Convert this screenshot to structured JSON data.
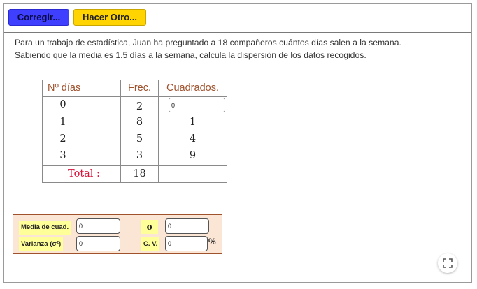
{
  "toolbar": {
    "fix_label": "Corregir...",
    "new_label": "Hacer Otro..."
  },
  "problem": {
    "line1": "Para un trabajo de estadística, Juan ha preguntado a 18 compañeros cuántos días salen a la semana.",
    "line2": "Sabiendo que la media es 1.5 días a la semana, calcula la dispersión de los datos recogidos."
  },
  "table": {
    "headers": [
      "Nº días",
      "Frec.",
      "Cuadrados."
    ],
    "rows": [
      {
        "days": "0",
        "freq": "2",
        "square": "0"
      },
      {
        "days": "1",
        "freq": "8",
        "square": "1"
      },
      {
        "days": "2",
        "freq": "5",
        "square": "4"
      },
      {
        "days": "3",
        "freq": "3",
        "square": "9"
      }
    ],
    "total_label": "Total :",
    "total_value": "18"
  },
  "results": {
    "mean_sq_label": "Media de cuad.",
    "mean_sq_value": "0",
    "variance_label": "Varianza (σ²)",
    "variance_value": "0",
    "sigma_label": "σ",
    "sigma_value": "0",
    "cv_label": "C. V.",
    "cv_value": "0",
    "percent": "%"
  },
  "colors": {
    "fix_button": "#3f3fff",
    "new_button": "#ffd400",
    "header_text": "#a0522d",
    "total_text": "#dc143c",
    "panel_bg": "#fbe5d4",
    "label_bg": "#ffff99"
  },
  "icons": {
    "fullscreen": "fullscreen-icon"
  }
}
